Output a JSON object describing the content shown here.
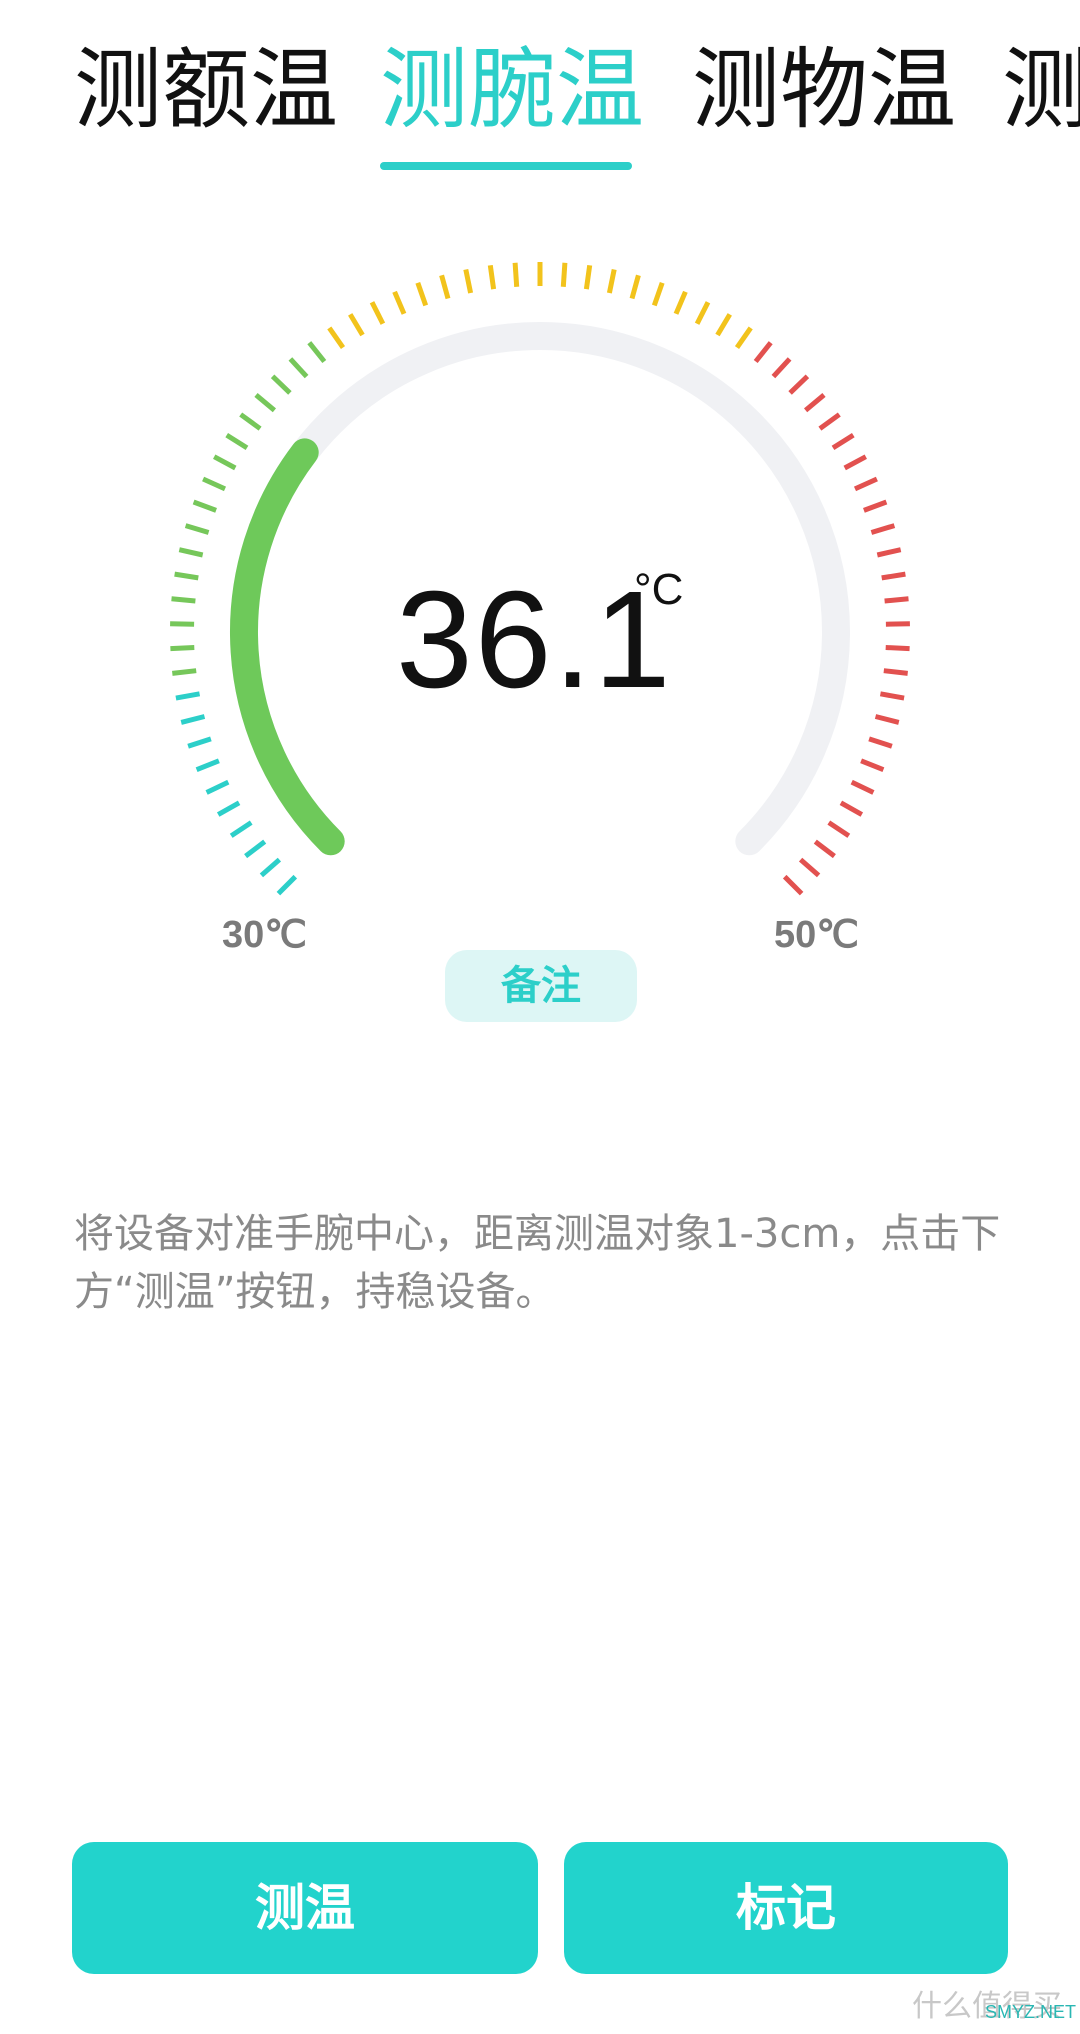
{
  "tabs": [
    {
      "label": "测额温",
      "active": false
    },
    {
      "label": "测腕温",
      "active": true
    },
    {
      "label": "测物温",
      "active": false
    },
    {
      "label": "测",
      "active": false
    }
  ],
  "gauge": {
    "reading": "36.1",
    "reading_unit": "°C",
    "min_label": "30℃",
    "max_label": "50℃",
    "min_value": 30,
    "max_value": 50,
    "current_value": 36.1,
    "colors": {
      "cyan": "#2ccfc9",
      "green": "#76c75a",
      "yellow": "#f2c31c",
      "red": "#e2514f",
      "track": "#f0f1f4",
      "progress": "#6ec95a"
    }
  },
  "note_button": {
    "label": "备注"
  },
  "instructions": "将设备对准手腕中心，距离测温对象1-3cm，点击下方“测温”按钮，持稳设备。",
  "buttons": {
    "measure_label": "测温",
    "mark_label": "标记"
  },
  "watermark": {
    "text": "什么值得买",
    "sub": "SMYZ.NET"
  }
}
